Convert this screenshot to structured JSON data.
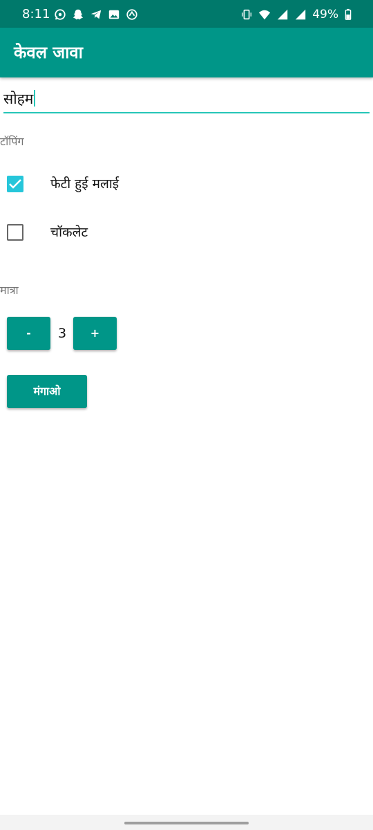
{
  "status_bar": {
    "time": "8:11",
    "battery": "49%",
    "left_icons": [
      "whatsapp-icon",
      "snapchat-icon",
      "telegram-icon",
      "gallery-icon",
      "sync-icon"
    ],
    "right_icons": [
      "vibrate-icon",
      "wifi-icon",
      "signal-icon",
      "signal-icon",
      "battery-icon"
    ]
  },
  "app_bar": {
    "title": "केवल जावा"
  },
  "form": {
    "name_value": "सोहम",
    "toppings_label": "टॉपिंग",
    "toppings": [
      {
        "label": "फेटी हुई मलाई",
        "checked": true
      },
      {
        "label": "चॉकलेट",
        "checked": false
      }
    ],
    "quantity_label": "मात्रा",
    "decrement_label": "-",
    "quantity": "3",
    "increment_label": "+",
    "order_label": "मंगाओ"
  },
  "colors": {
    "status_bar": "#00796B",
    "primary": "#009688",
    "accent": "#26C6DA"
  }
}
